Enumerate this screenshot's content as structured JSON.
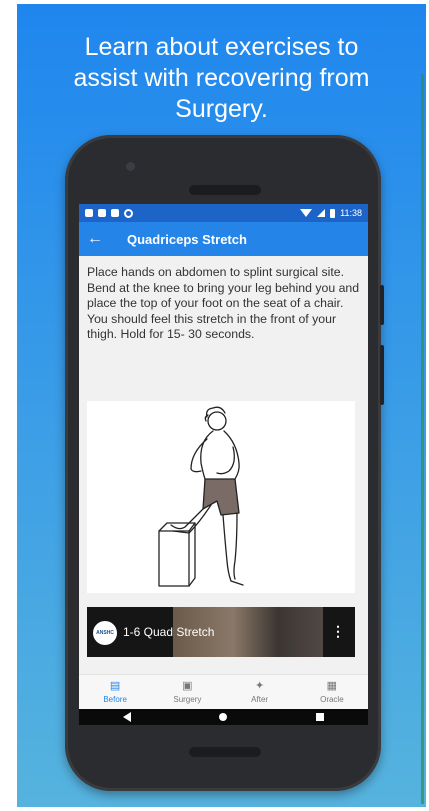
{
  "promo": {
    "headline_lines": [
      "Learn about exercises to",
      "assist with recovering from",
      "Surgery."
    ],
    "background_top": "#1f86ee",
    "background_bottom": "#56b3de"
  },
  "status_bar": {
    "time": "11:38",
    "left_icons": [
      "notification-icon",
      "image-icon",
      "sd-card-icon",
      "sync-icon"
    ],
    "right_icons": [
      "wifi-icon",
      "signal-icon",
      "battery-icon"
    ]
  },
  "app_bar": {
    "back_icon": "arrow-left-icon",
    "title": "Quadriceps Stretch",
    "color": "#2584e8"
  },
  "exercise": {
    "description": "Place hands on abdomen to splint surgical site. Bend at the knee to bring your leg behind you and place the top of your foot on the seat of a chair. You should feel this stretch in the front of your thigh. Hold for 15- 30 seconds."
  },
  "video": {
    "title": "1-6 Quad Stretch",
    "menu_icon": "more-vert-icon"
  },
  "bottom_nav": {
    "items": [
      {
        "label": "Before",
        "icon": "clipboard-icon",
        "active": true
      },
      {
        "label": "Surgery",
        "icon": "hospital-bed-icon",
        "active": false
      },
      {
        "label": "After",
        "icon": "walking-person-icon",
        "active": false
      },
      {
        "label": "Oracle",
        "icon": "document-icon",
        "active": false
      }
    ]
  },
  "system_nav": {
    "buttons": [
      "back-triangle-icon",
      "home-circle-icon",
      "recents-square-icon"
    ]
  }
}
